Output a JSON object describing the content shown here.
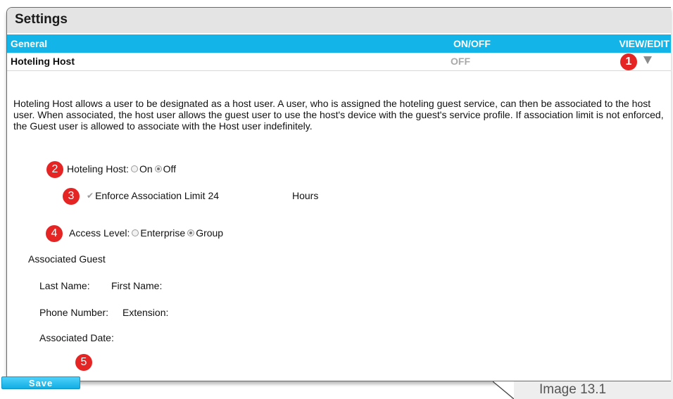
{
  "panel": {
    "title": "Settings"
  },
  "header": {
    "general": "General",
    "onoff": "ON/OFF",
    "view_edit": "VIEW/EDIT"
  },
  "host_row": {
    "name": "Hoteling Host",
    "status": "OFF",
    "expand_icon": "caret-down-icon"
  },
  "description": "Hoteling Host allows a user to be designated as a host user. A user, who is assigned the hoteling guest service, can then be associated to the host user. When associated, the host user allows the guest user to use the host's device with the guest's service profile. If association limit is not enforced, the Guest user is allowed to associate with the Host user indefinitely.",
  "markers": [
    "1",
    "2",
    "3",
    "4",
    "5"
  ],
  "hoteling_host": {
    "label": "Hoteling Host:",
    "options": [
      "On",
      "Off"
    ],
    "selected": "Off"
  },
  "enforce": {
    "label": "Enforce Association Limit",
    "value": "24",
    "unit": "Hours",
    "checked": true,
    "disabled": true
  },
  "access_level": {
    "label": "Access Level:",
    "options": [
      "Enterprise",
      "Group"
    ],
    "selected": "Group"
  },
  "associated_guest": {
    "heading": "Associated Guest",
    "last_name_label": "Last Name:",
    "first_name_label": "First Name:",
    "phone_label": "Phone Number:",
    "extension_label": "Extension:",
    "date_label": "Associated Date:"
  },
  "save_label": "Save",
  "caption": "Image 13.1",
  "colors": {
    "header_bg": "#13b4e8",
    "marker": "#e52424",
    "title_bar": "#e4e4e4"
  }
}
